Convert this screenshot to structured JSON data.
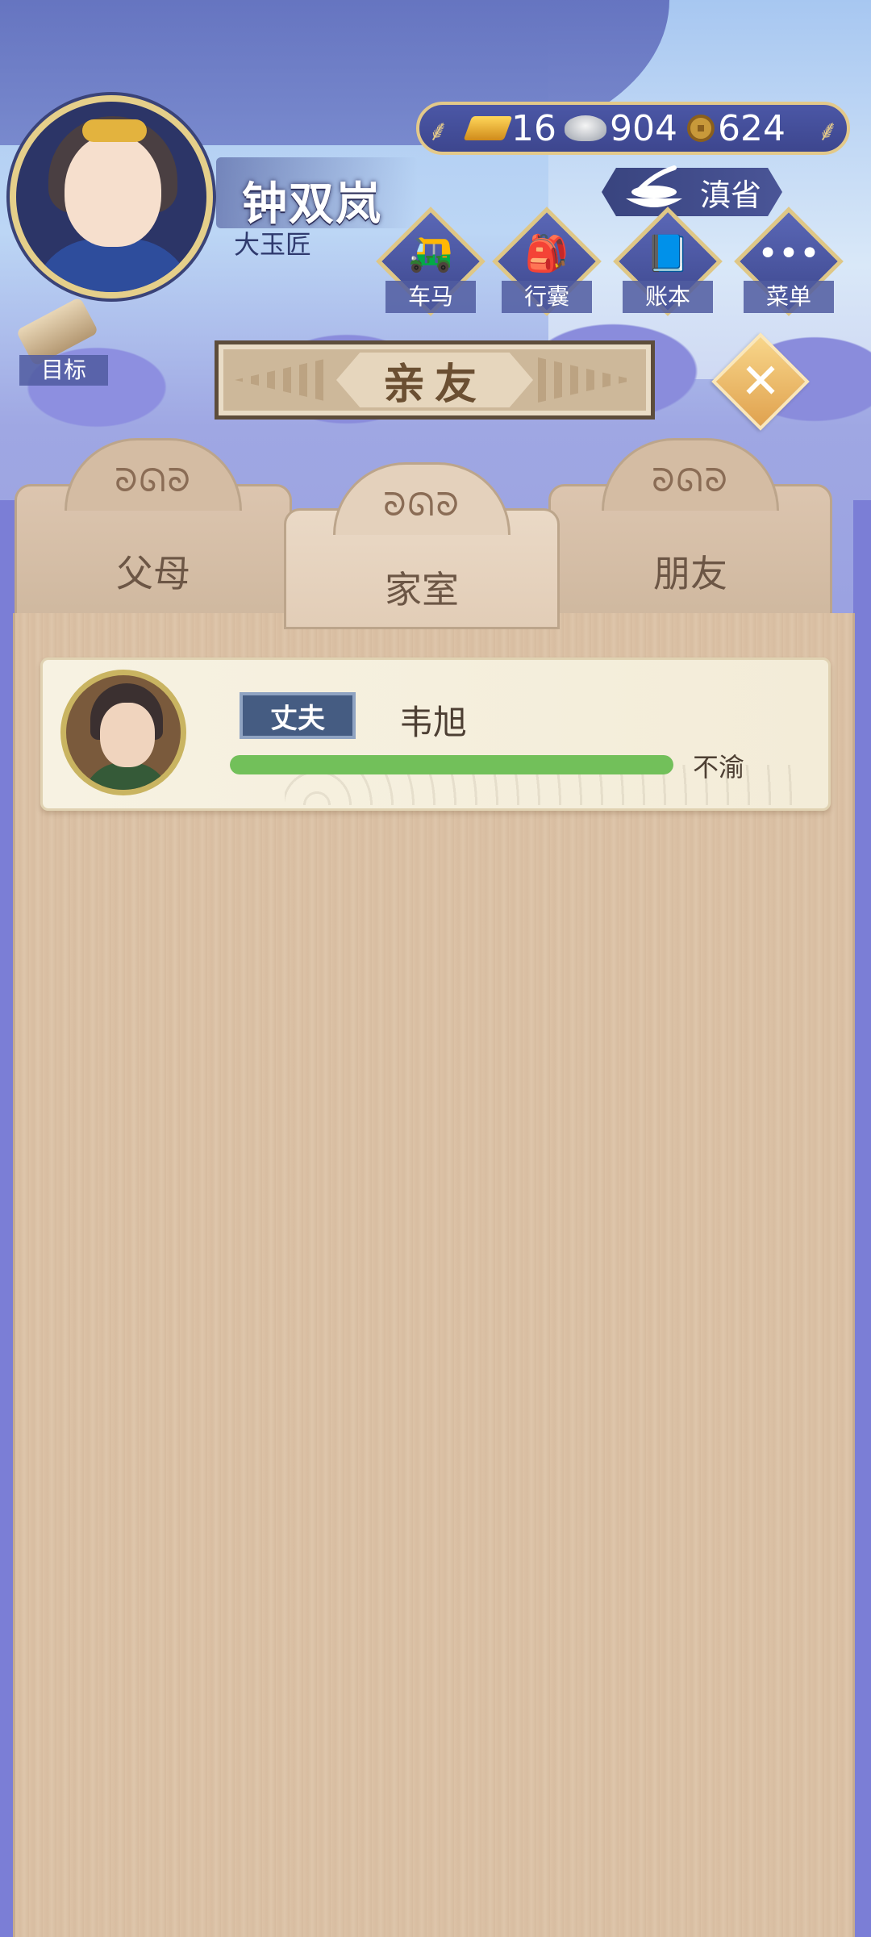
{
  "player": {
    "name": "钟双岚",
    "title": "大玉匠"
  },
  "currency": {
    "gold": "16",
    "silver": "904",
    "copper": "624"
  },
  "region": "滇省",
  "menu": [
    {
      "label": "车马",
      "icon": "carriage-icon"
    },
    {
      "label": "行囊",
      "icon": "bag-icon"
    },
    {
      "label": "账本",
      "icon": "ledger-icon"
    },
    {
      "label": "菜单",
      "icon": "more-icon"
    }
  ],
  "goal_label": "目标",
  "header_title": "亲友",
  "tabs": [
    {
      "label": "父母",
      "active": false
    },
    {
      "label": "家室",
      "active": true
    },
    {
      "label": "朋友",
      "active": false
    }
  ],
  "relations": [
    {
      "relation": "丈夫",
      "name": "韦旭",
      "status": "不渝",
      "affinity": 1.0
    }
  ],
  "colors": {
    "affinity_fill": "#72c05a",
    "relation_tag": "#455c82",
    "panel_wood": "#dcc2a6"
  }
}
